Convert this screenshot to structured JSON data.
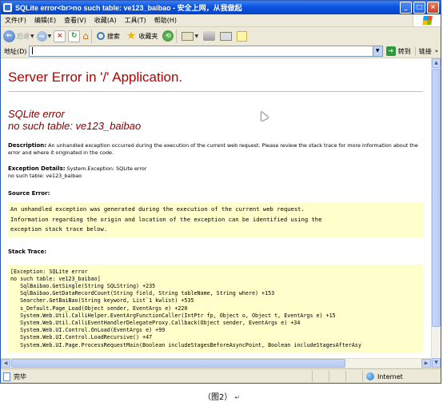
{
  "window": {
    "title": "SQLite error<br>no such table: ve123_baibao - 安全上网，从我做起",
    "controls": [
      "_",
      "□",
      "×"
    ]
  },
  "menu": [
    "文件(F)",
    "编辑(E)",
    "查看(V)",
    "收藏(A)",
    "工具(T)",
    "帮助(H)"
  ],
  "toolbar": {
    "back_label": "后退",
    "search_label": "搜索",
    "favorites_label": "收藏夹"
  },
  "address": {
    "label": "地址(D)",
    "value": "",
    "go_label": "转到",
    "links_label": "链接"
  },
  "page": {
    "heading": "Server Error in '/' Application.",
    "error_title_line1": "SQLite error",
    "error_title_line2": "no such table: ve123_baibao",
    "description_label": "Description:",
    "description_text": " An unhandled exception occurred during the execution of the current web request. Please review the stack trace for more information about the error and where it originated in the code.",
    "exception_label": "Exception Details:",
    "exception_text": " System.Exception: SQLite error",
    "exception_text2": "no such table: ve123_baibao",
    "source_error_label": "Source Error:",
    "source_error_text": "An unhandled exception was generated during the execution of the current web request.\nInformation regarding the origin and location of the exception can be identified using the\nexception stack trace below.",
    "stack_trace_label": "Stack Trace:",
    "stack_trace_text": "[Exception: SQLite error\nno such table: ve123_baibao]\n   SqlBaibao.GetSingle(String SQLString) +235\n   SqlBaibao.GetDataRecordCount(String field, String tableName, String where) +153\n   Searcher.GetBaiBao(String keyword, List`1 kwlist) +535\n   s_Default.Page_Load(Object sender, EventArgs e) +220\n   System.Web.Util.CalliHelper.EventArgFunctionCaller(IntPtr fp, Object o, Object t, EventArgs e) +15\n   System.Web.Util.CalliEventHandlerDelegateProxy.Callback(Object sender, EventArgs e) +34\n   System.Web.UI.Control.OnLoad(EventArgs e) +99\n   System.Web.UI.Control.LoadRecursive() +47\n   System.Web.UI.Page.ProcessRequestMain(Boolean includeStagesBeforeAsyncPoint, Boolean includeStagesAfterAsy"
  },
  "status": {
    "text": "完毕",
    "zone": "Internet"
  },
  "caption": "（图2）",
  "caption_mark": "↵",
  "icons": [
    "app-icon",
    "back-icon",
    "forward-icon",
    "stop-icon",
    "refresh-icon",
    "home-icon",
    "search-icon",
    "favorites-star-icon",
    "history-icon",
    "mail-icon",
    "print-icon",
    "edit-icon",
    "go-arrow-icon",
    "globe-icon",
    "page-icon",
    "windows-logo-icon"
  ]
}
